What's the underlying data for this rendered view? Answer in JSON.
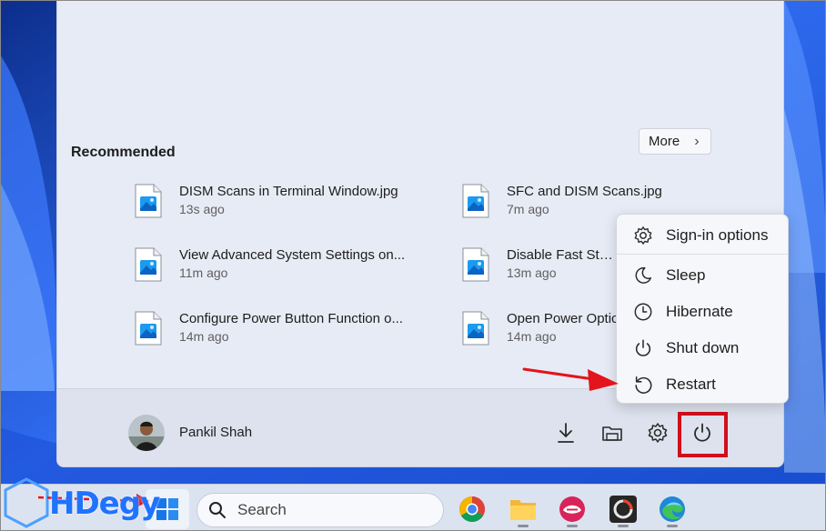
{
  "start_menu": {
    "recommended_title": "Recommended",
    "more_label": "More",
    "items": [
      {
        "name": "DISM Scans in Terminal Window.jpg",
        "time": "13s ago"
      },
      {
        "name": "SFC and DISM Scans.jpg",
        "time": "7m ago"
      },
      {
        "name": "View Advanced System Settings on...",
        "time": "11m ago"
      },
      {
        "name": "Disable Fast Startu",
        "time": "13m ago"
      },
      {
        "name": "Configure Power Button Function o...",
        "time": "14m ago"
      },
      {
        "name": "Open Power Optic",
        "time": "14m ago"
      }
    ],
    "user_name": "Pankil Shah"
  },
  "power_menu": {
    "items": [
      {
        "label": "Sign-in options",
        "icon": "gear-icon"
      },
      {
        "label": "Sleep",
        "icon": "moon-icon"
      },
      {
        "label": "Hibernate",
        "icon": "clock-icon"
      },
      {
        "label": "Shut down",
        "icon": "power-icon"
      },
      {
        "label": "Restart",
        "icon": "restart-icon"
      }
    ]
  },
  "taskbar": {
    "search_placeholder": "Search",
    "apps": [
      "chrome-icon",
      "file-explorer-icon",
      "app-icon",
      "app-icon-2",
      "edge-icon"
    ]
  },
  "watermark": {
    "text": "HDegy"
  },
  "colors": {
    "highlight": "#d10f1a",
    "accent": "#1f73ff"
  }
}
